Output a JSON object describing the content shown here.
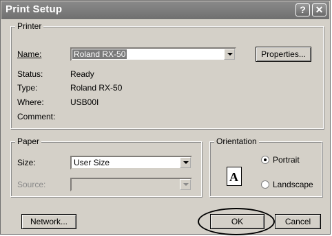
{
  "window": {
    "title": "Print Setup",
    "help_glyph": "?",
    "close_glyph": "✕"
  },
  "printer": {
    "group_label": "Printer",
    "name_label": "Name:",
    "name_value": "Roland RX-50",
    "properties_label": "Properties...",
    "status_label": "Status:",
    "status_value": "Ready",
    "type_label": "Type:",
    "type_value": "Roland RX-50",
    "where_label": "Where:",
    "where_value": "USB00I",
    "comment_label": "Comment:"
  },
  "paper": {
    "group_label": "Paper",
    "size_label": "Size:",
    "size_value": "User Size",
    "source_label": "Source:",
    "source_value": ""
  },
  "orientation": {
    "group_label": "Orientation",
    "page_glyph": "A",
    "portrait_label": "Portrait",
    "landscape_label": "Landscape",
    "selected": "portrait"
  },
  "buttons": {
    "network": "Network...",
    "ok": "OK",
    "cancel": "Cancel"
  }
}
